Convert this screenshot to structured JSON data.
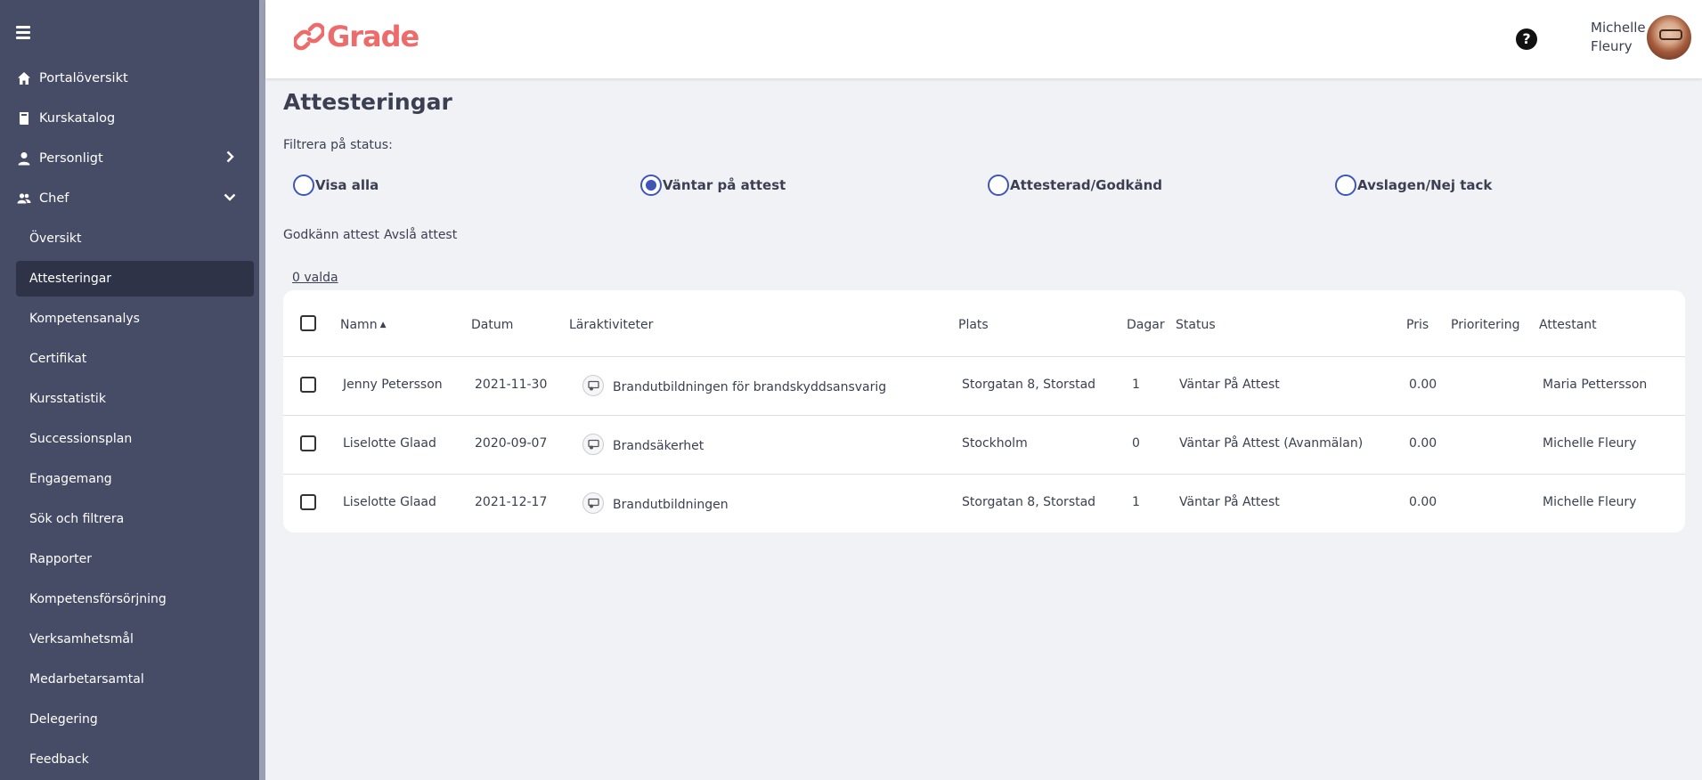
{
  "app": {
    "logo_text": "Grade"
  },
  "sidebar": {
    "items": [
      {
        "label": "Portalöversikt",
        "icon": "home-icon"
      },
      {
        "label": "Kurskatalog",
        "icon": "book-icon"
      },
      {
        "label": "Personligt",
        "icon": "user-icon",
        "chevron": "right"
      },
      {
        "label": "Chef",
        "icon": "users-icon",
        "chevron": "down"
      }
    ],
    "sub_items": [
      "Översikt",
      "Attesteringar",
      "Kompetensanalys",
      "Certifikat",
      "Kursstatistik",
      "Successionsplan",
      "Engagemang",
      "Sök och filtrera",
      "Rapporter",
      "Kompetensförsörjning",
      "Verksamhetsmål",
      "Medarbetarsamtal",
      "Delegering",
      "Feedback"
    ],
    "active_sub_item": "Attesteringar"
  },
  "header": {
    "help_icon": "question-circle-icon",
    "user_first_name": "Michelle",
    "user_last_name": "Fleury"
  },
  "main": {
    "title": "Attesteringar",
    "filter_label": "Filtrera på status:",
    "filters": [
      {
        "label": "Visa alla",
        "selected": false
      },
      {
        "label": "Väntar på attest",
        "selected": true
      },
      {
        "label": "Attesterad/Godkänd",
        "selected": false
      },
      {
        "label": "Avslagen/Nej tack",
        "selected": false
      }
    ],
    "actions": {
      "approve": "Godkänn attest",
      "reject": "Avslå attest"
    },
    "selected_count": "0 valda",
    "table": {
      "headers": {
        "name": "Namn",
        "date": "Datum",
        "activities": "Läraktiviteter",
        "place": "Plats",
        "days": "Dagar",
        "status": "Status",
        "price": "Pris",
        "priority": "Prioritering",
        "approver": "Attestant"
      },
      "rows": [
        {
          "name": "Jenny Petersson",
          "date": "2021-11-30",
          "activity": "Brandutbildningen för brandskyddsansvarig",
          "place": "Storgatan 8, Storstad",
          "days": "1",
          "status": "Väntar På Attest",
          "price": "0.00",
          "priority": "",
          "approver": "Maria Pettersson"
        },
        {
          "name": "Liselotte Glaad",
          "date": "2020-09-07",
          "activity": "Brandsäkerhet",
          "place": "Stockholm",
          "days": "0",
          "status": "Väntar På Attest (Avanmälan)",
          "price": "0.00",
          "priority": "",
          "approver": "Michelle Fleury"
        },
        {
          "name": "Liselotte Glaad",
          "date": "2021-12-17",
          "activity": "Brandutbildningen",
          "place": "Storgatan 8, Storstad",
          "days": "1",
          "status": "Väntar På Attest",
          "price": "0.00",
          "priority": "",
          "approver": "Michelle Fleury"
        }
      ]
    }
  },
  "colors": {
    "sidebar_bg": "#464b66",
    "sidebar_active": "#2f3348",
    "brand": "#ee6b6b",
    "radio_accent": "#3d56b8"
  }
}
